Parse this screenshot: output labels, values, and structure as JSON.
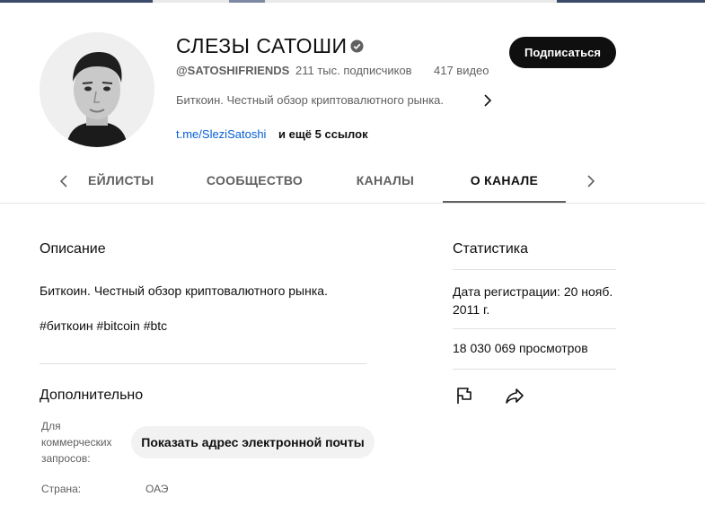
{
  "channel": {
    "title": "СЛЕЗЫ САТОШИ",
    "handle": "@SATOSHIFRIENDS",
    "subscribers": "211 тыс. подписчиков",
    "videos": "417 видео",
    "short_description": "Биткоин. Честный обзор криптовалютного рынка.",
    "link": "t.me/SleziSatoshi",
    "link_more": "и ещё 5 ссылок",
    "subscribe_label": "Подписаться"
  },
  "tabs": [
    {
      "label": "ЕЙЛИСТЫ"
    },
    {
      "label": "СООБЩЕСТВО"
    },
    {
      "label": "КАНАЛЫ"
    },
    {
      "label": "О КАНАЛЕ",
      "active": true
    }
  ],
  "about": {
    "description_heading": "Описание",
    "description_text": "Биткоин. Честный обзор криптовалютного рынка.",
    "hashtags": "#биткоин #bitcoin #btc",
    "additional_heading": "Дополнительно",
    "business_label": "Для коммерческих запросов:",
    "show_email_label": "Показать адрес электронной почты",
    "country_label": "Страна:",
    "country_value": "ОАЭ"
  },
  "stats": {
    "heading": "Статистика",
    "registration": "Дата регистрации: 20 нояб. 2011 г.",
    "views": "18 030 069 просмотров"
  },
  "colors": {
    "accent_link": "#065fd4",
    "subscribe_bg": "#0f0f0f",
    "secondary_text": "#606060"
  },
  "icons": [
    "verified-badge-icon",
    "chevron-right-icon",
    "chevron-left-icon",
    "flag-icon",
    "share-icon"
  ]
}
